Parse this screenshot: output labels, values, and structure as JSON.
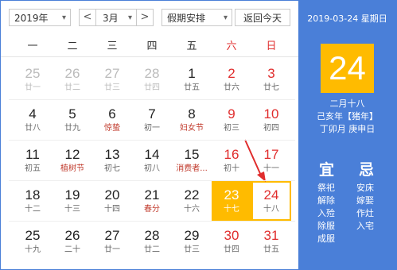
{
  "toolbar": {
    "year": "2019年",
    "prev_label": "<",
    "month": "3月",
    "next_label": ">",
    "holiday": "假期安排",
    "today_button": "返回今天",
    "dropdown_arrow": "▾"
  },
  "weekdays": [
    "一",
    "二",
    "三",
    "四",
    "五",
    "六",
    "日"
  ],
  "weeks": [
    [
      {
        "d": "25",
        "l": "廿一",
        "o": true
      },
      {
        "d": "26",
        "l": "廿二",
        "o": true
      },
      {
        "d": "27",
        "l": "廿三",
        "o": true
      },
      {
        "d": "28",
        "l": "廿四",
        "o": true
      },
      {
        "d": "1",
        "l": "廿五"
      },
      {
        "d": "2",
        "l": "廿六",
        "we": true
      },
      {
        "d": "3",
        "l": "廿七",
        "we": true
      }
    ],
    [
      {
        "d": "4",
        "l": "廿八"
      },
      {
        "d": "5",
        "l": "廿九"
      },
      {
        "d": "6",
        "l": "惊蛰",
        "f": true
      },
      {
        "d": "7",
        "l": "初一"
      },
      {
        "d": "8",
        "l": "妇女节",
        "f": true
      },
      {
        "d": "9",
        "l": "初三",
        "we": true
      },
      {
        "d": "10",
        "l": "初四",
        "we": true
      }
    ],
    [
      {
        "d": "11",
        "l": "初五"
      },
      {
        "d": "12",
        "l": "植树节",
        "f": true
      },
      {
        "d": "13",
        "l": "初七"
      },
      {
        "d": "14",
        "l": "初八"
      },
      {
        "d": "15",
        "l": "消费者...",
        "f": true
      },
      {
        "d": "16",
        "l": "初十",
        "we": true
      },
      {
        "d": "17",
        "l": "十一",
        "we": true
      }
    ],
    [
      {
        "d": "18",
        "l": "十二"
      },
      {
        "d": "19",
        "l": "十三"
      },
      {
        "d": "20",
        "l": "十四"
      },
      {
        "d": "21",
        "l": "春分",
        "f": true
      },
      {
        "d": "22",
        "l": "十六"
      },
      {
        "d": "23",
        "l": "十七",
        "t": true
      },
      {
        "d": "24",
        "l": "十八",
        "s": true
      }
    ],
    [
      {
        "d": "25",
        "l": "十九"
      },
      {
        "d": "26",
        "l": "二十"
      },
      {
        "d": "27",
        "l": "廿一"
      },
      {
        "d": "28",
        "l": "廿二"
      },
      {
        "d": "29",
        "l": "廿三"
      },
      {
        "d": "30",
        "l": "廿四",
        "we": true
      },
      {
        "d": "31",
        "l": "廿五",
        "we": true
      }
    ]
  ],
  "panel": {
    "date_header": "2019-03-24 星期日",
    "big_day": "24",
    "lunar_date": "二月十八",
    "year_ganzhi": "己亥年【猪年】",
    "month_day_ganzhi": "丁卯月 庚申日",
    "yi_label": "宜",
    "ji_label": "忌",
    "yi_items": [
      "祭祀",
      "解除",
      "入殓",
      "除服",
      "成服"
    ],
    "ji_items": [
      "安床",
      "嫁娶",
      "作灶",
      "入宅"
    ]
  },
  "colors": {
    "accent_blue": "#4a7fd8",
    "today_yellow": "#ffbb00",
    "weekend_red": "#e02d2d"
  }
}
